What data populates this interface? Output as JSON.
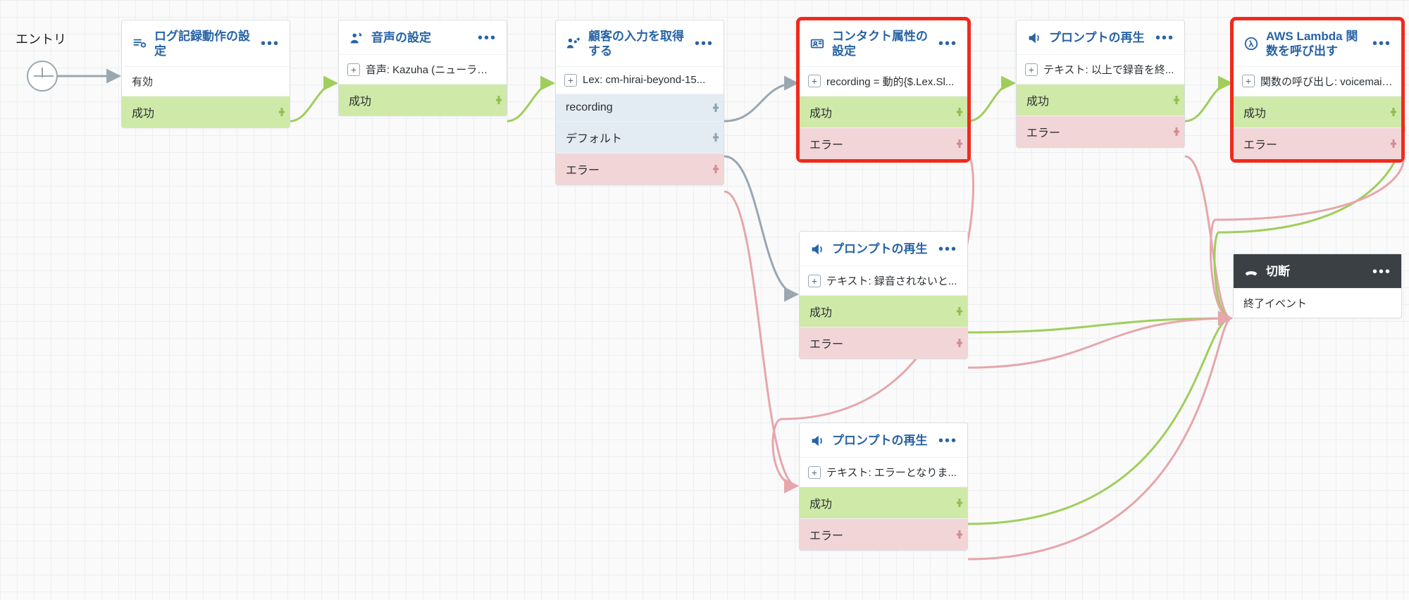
{
  "entry": {
    "label": "エントリ"
  },
  "outcomes": {
    "success": "成功",
    "error": "エラー",
    "default": "デフォルト",
    "recording": "recording"
  },
  "nodes": {
    "logging": {
      "title": "ログ記録動作の設定",
      "body": "有効"
    },
    "voice": {
      "title": "音声の設定",
      "detail": "音声: Kazuha (ニューラル:..."
    },
    "getInput": {
      "title": "顧客の入力を取得する",
      "detail": "Lex: cm-hirai-beyond-15..."
    },
    "setAttr": {
      "title": "コンタクト属性の設定",
      "detail": "recording = 動的{$.Lex.Sl..."
    },
    "prompt1": {
      "title": "プロンプトの再生",
      "detail": "テキスト: 以上で録音を終..."
    },
    "lambda": {
      "title": "AWS Lambda 関数を呼び出す",
      "detail": "関数の呼び出し: voicemail..."
    },
    "prompt2": {
      "title": "プロンプトの再生",
      "detail": "テキスト: 録音されないと..."
    },
    "prompt3": {
      "title": "プロンプトの再生",
      "detail": "テキスト: エラーとなりま..."
    },
    "disconnect": {
      "title": "切断",
      "body": "終了イベント"
    }
  }
}
